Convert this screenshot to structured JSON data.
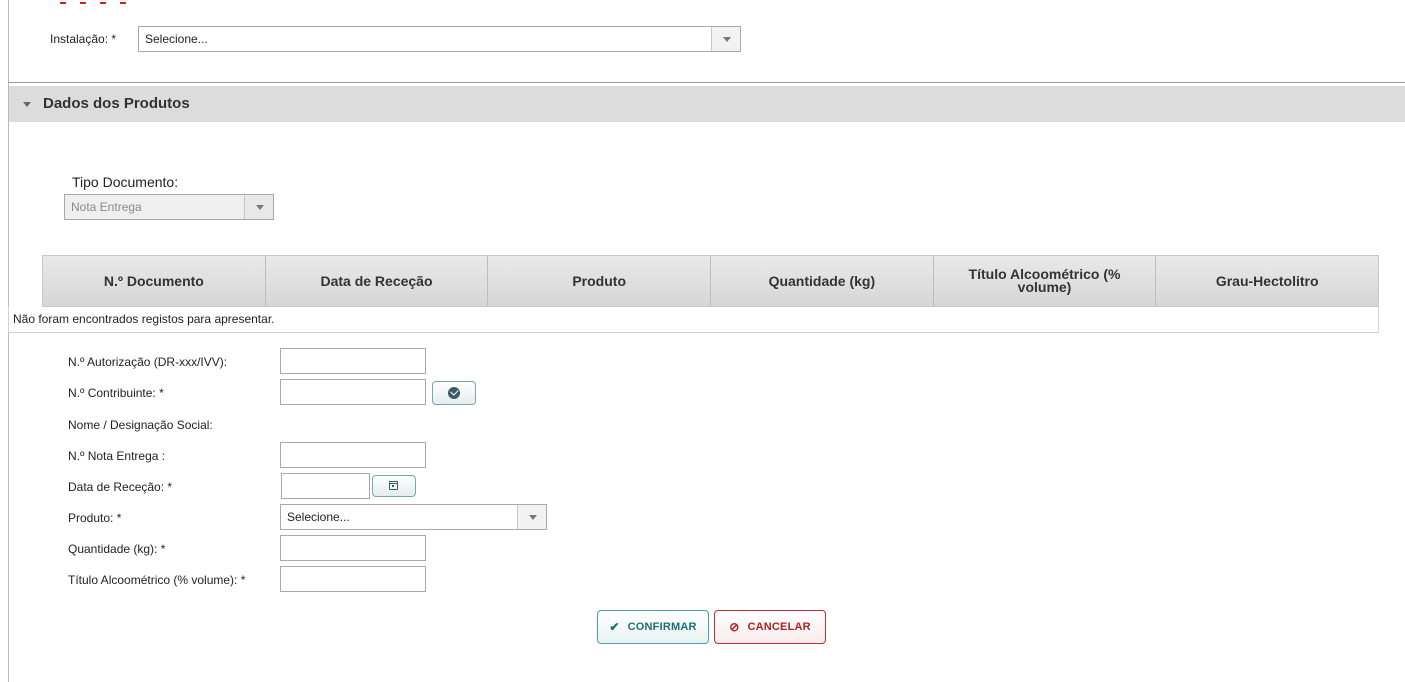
{
  "installation": {
    "label": "Instalação: *",
    "value": "Selecione..."
  },
  "section": {
    "title": "Dados dos Produtos"
  },
  "document_type": {
    "label": "Tipo Documento:",
    "value": "Nota Entrega"
  },
  "table": {
    "columns": [
      "N.º Documento",
      "Data de Receção",
      "Produto",
      "Quantidade (kg)",
      "Título Alcoométrico (% volume)",
      "Grau-Hectolitro"
    ],
    "empty_message": "Não foram encontrados registos para apresentar."
  },
  "form": {
    "authorization_label": "N.º Autorização (DR-xxx/IVV):",
    "authorization_value": "",
    "taxpayer_label": "N.º Contribuinte: *",
    "taxpayer_value": "",
    "name_label": "Nome / Designação Social:",
    "delivery_note_label": "N.º Nota Entrega :",
    "delivery_note_value": "",
    "reception_date_label": "Data de Receção: *",
    "reception_date_value": "",
    "product_label": "Produto: *",
    "product_value": "Selecione...",
    "quantity_label": "Quantidade (kg): *",
    "quantity_value": "",
    "alcohol_label": "Título Alcoométrico (% volume): *",
    "alcohol_value": ""
  },
  "buttons": {
    "confirm": "CONFIRMAR",
    "cancel": "CANCELAR"
  },
  "icons": {
    "validate": "check-circle-icon",
    "calendar": "calendar-icon",
    "confirm": "check-icon",
    "cancel": "ban-icon",
    "collapse": "triangle-down-icon",
    "dropdown": "chevron-down-icon"
  },
  "colors": {
    "section_bar": "#dcdcdc",
    "confirm_accent": "#4aa3a3",
    "cancel_accent": "#c0302c"
  }
}
